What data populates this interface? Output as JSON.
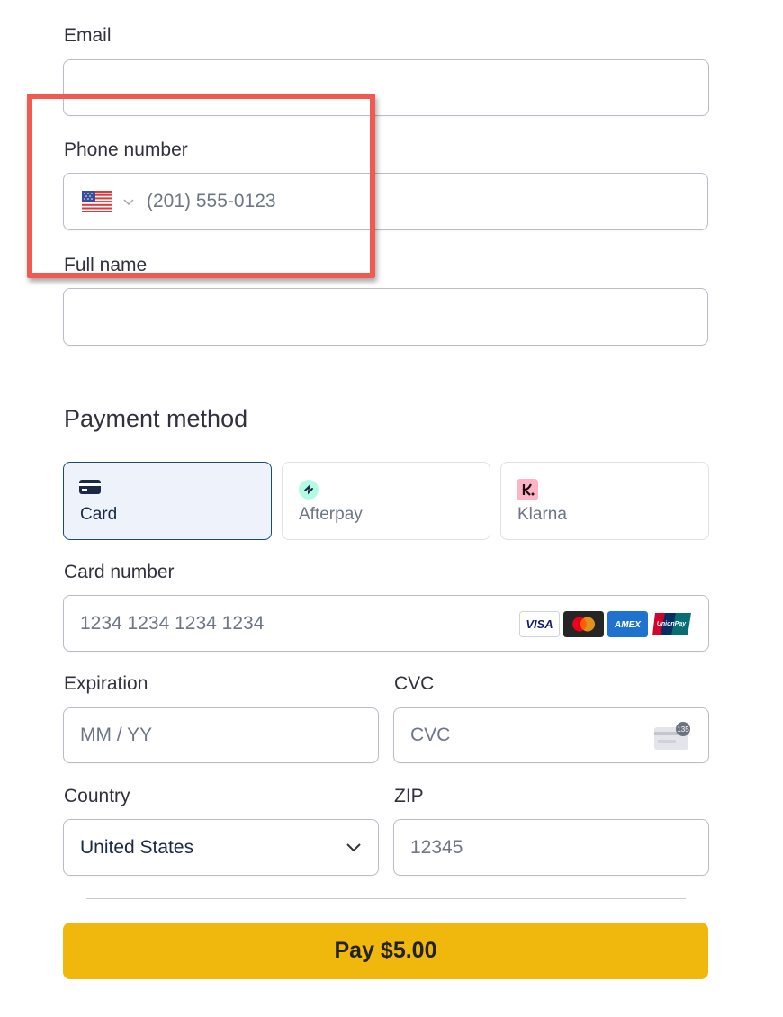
{
  "contact": {
    "email_label": "Email",
    "email_value": "",
    "phone_label": "Phone number",
    "phone_country_flag": "us-flag-icon",
    "phone_placeholder": "(201) 555-0123",
    "name_label": "Full name",
    "name_value": ""
  },
  "payment": {
    "title": "Payment method",
    "tabs": [
      {
        "label": "Card",
        "icon": "card-icon",
        "selected": true
      },
      {
        "label": "Afterpay",
        "icon": "afterpay-icon",
        "selected": false
      },
      {
        "label": "Klarna",
        "icon": "klarna-icon",
        "selected": false
      }
    ],
    "card_number_label": "Card number",
    "card_number_placeholder": "1234 1234 1234 1234",
    "card_brands": [
      "VISA",
      "Mastercard",
      "AMEX",
      "UnionPay"
    ],
    "expiration_label": "Expiration",
    "expiration_placeholder": "MM / YY",
    "cvc_label": "CVC",
    "cvc_placeholder": "CVC",
    "cvc_badge": "135",
    "country_label": "Country",
    "country_value": "United States",
    "zip_label": "ZIP",
    "zip_placeholder": "12345"
  },
  "pay_button_label": "Pay $5.00",
  "colors": {
    "highlight": "#f15a50",
    "pay_button": "#f0b70d",
    "selected_tab_bg": "#eef2fb",
    "selected_tab_border": "#1a4a75"
  }
}
